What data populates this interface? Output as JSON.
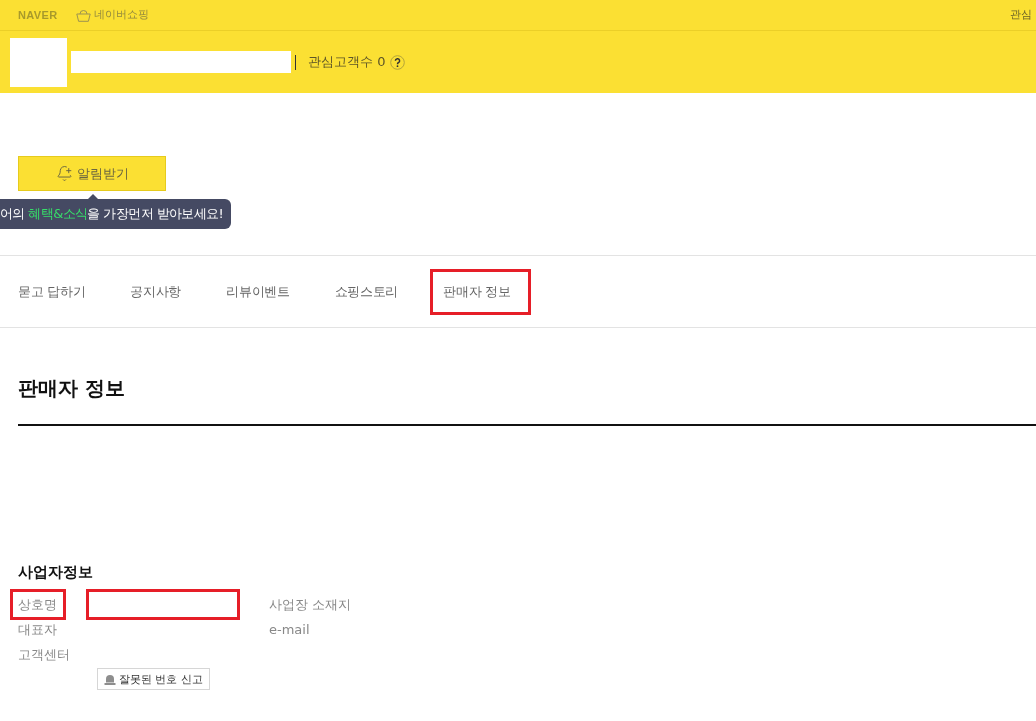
{
  "top_bar": {
    "brand": "NAVER",
    "service": "네이버쇼핑",
    "right_link": "관심"
  },
  "store_header": {
    "followers": "관심고객수 0"
  },
  "notify_button": {
    "label": "알림받기"
  },
  "tooltip": {
    "segments": [
      {
        "text": "어의 ",
        "highlight": false
      },
      {
        "text": "혜택&소식",
        "highlight": true
      },
      {
        "text": "을 가장먼저 받아보세요!",
        "highlight": false
      }
    ]
  },
  "tabs": [
    {
      "label": "묻고 답하기",
      "annotated": false
    },
    {
      "label": "공지사항",
      "annotated": false
    },
    {
      "label": "리뷰이벤트",
      "annotated": false
    },
    {
      "label": "쇼핑스토리",
      "annotated": false
    },
    {
      "label": "판매자 정보",
      "annotated": true
    }
  ],
  "section_title": "판매자 정보",
  "business_info": {
    "title": "사업자정보",
    "rows": [
      {
        "label": "상호명",
        "label_annotated": true,
        "value_annotated": true,
        "side_label": "사업장 소재지"
      },
      {
        "label": "대표자",
        "label_annotated": false,
        "value_annotated": false,
        "side_label": "e-mail"
      },
      {
        "label": "고객센터",
        "label_annotated": false,
        "value_annotated": false
      }
    ],
    "report_button": "잘못된 번호 신고"
  }
}
